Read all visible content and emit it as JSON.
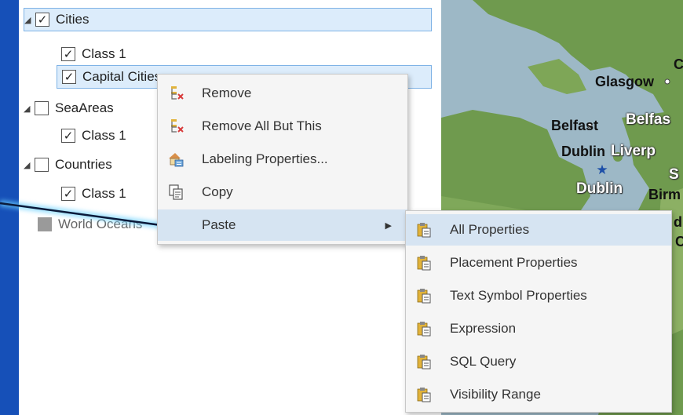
{
  "tree": {
    "cities": "Cities",
    "cities_class": "Class 1",
    "capital_cities": "Capital Cities",
    "sea_areas": "SeaAreas",
    "sea_class": "Class 1",
    "countries": "Countries",
    "countries_class": "Class 1",
    "world_oceans": "World Oceans"
  },
  "context_menu": {
    "remove": "Remove",
    "remove_all_but_this": "Remove All But This",
    "labeling_properties": "Labeling Properties...",
    "copy": "Copy",
    "paste": "Paste"
  },
  "paste_submenu": {
    "all_properties": "All Properties",
    "placement_properties": "Placement Properties",
    "text_symbol_properties": "Text Symbol Properties",
    "expression": "Expression",
    "sql_query": "SQL Query",
    "visibility_range": "Visibility Range"
  },
  "map": {
    "glasgow": "Glasgow",
    "belfast": "Belfast",
    "belfast_halo": "Belfas",
    "dublin": "Dublin",
    "dublin_halo": "Dublin",
    "liverpool_halo": "Liverp",
    "birmingham_halo": "Birm",
    "frag_c": "C",
    "frag_s": "S",
    "frag_d": "d",
    "frag_c2": "C"
  },
  "colors": {
    "background": "#1650b8",
    "selection": "#dcecfb",
    "menu_highlight": "#d6e4f2",
    "land": "#6f9a4e",
    "water": "#9db8c6",
    "capital_star": "#1d4fa8"
  },
  "icons": {
    "remove": "remove-layer-icon",
    "remove_all": "remove-all-but-this-icon",
    "labeling": "labeling-properties-icon",
    "copy": "copy-icon",
    "paste_submenu": "clipboard-paste-icon",
    "submenu_arrow": "chevron-right-icon"
  }
}
